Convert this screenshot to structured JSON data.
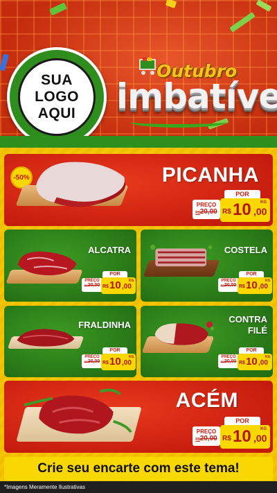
{
  "header": {
    "logo_lines": [
      "SUA",
      "LOGO",
      "AQUI"
    ],
    "title_top": "Outubro",
    "title_main": "imbatível"
  },
  "products": [
    {
      "name": "PICANHA",
      "badge": "-50%",
      "por": "POR",
      "old_label": "PREÇO",
      "old_prefix": "R$",
      "old_value": "20,00",
      "currency": "R$",
      "new_int": "10",
      "new_dec": ",00",
      "unit": "KG"
    },
    {
      "name": "ALCATRA",
      "por": "POR",
      "old_label": "PREÇO",
      "old_prefix": "R$",
      "old_value": "20,00",
      "currency": "R$",
      "new_int": "10",
      "new_dec": ",00",
      "unit": "KG"
    },
    {
      "name": "COSTELA",
      "por": "POR",
      "old_label": "PREÇO",
      "old_prefix": "R$",
      "old_value": "20,00",
      "currency": "R$",
      "new_int": "10",
      "new_dec": ",00",
      "unit": "KG"
    },
    {
      "name": "FRALDINHA",
      "por": "POR",
      "old_label": "PREÇO",
      "old_prefix": "R$",
      "old_value": "20,00",
      "currency": "R$",
      "new_int": "10",
      "new_dec": ",00",
      "unit": "KG"
    },
    {
      "name_line1": "CONTRA",
      "name_line2": "FILÉ",
      "por": "POR",
      "old_label": "PREÇO",
      "old_prefix": "R$",
      "old_value": "20,00",
      "currency": "R$",
      "new_int": "10",
      "new_dec": ",00",
      "unit": "KG"
    },
    {
      "name": "ACÉM",
      "por": "POR",
      "old_label": "PREÇO",
      "old_prefix": "R$",
      "old_value": "20,00",
      "currency": "R$",
      "new_int": "10",
      "new_dec": ",00",
      "unit": "KG"
    }
  ],
  "footer": {
    "cta": "Crie seu encarte com este tema!",
    "note": "*Imagens Meramente Ilustrativas"
  },
  "colors": {
    "red": "#c51b0e",
    "green": "#2e8d1c",
    "yellow": "#f8d800"
  }
}
